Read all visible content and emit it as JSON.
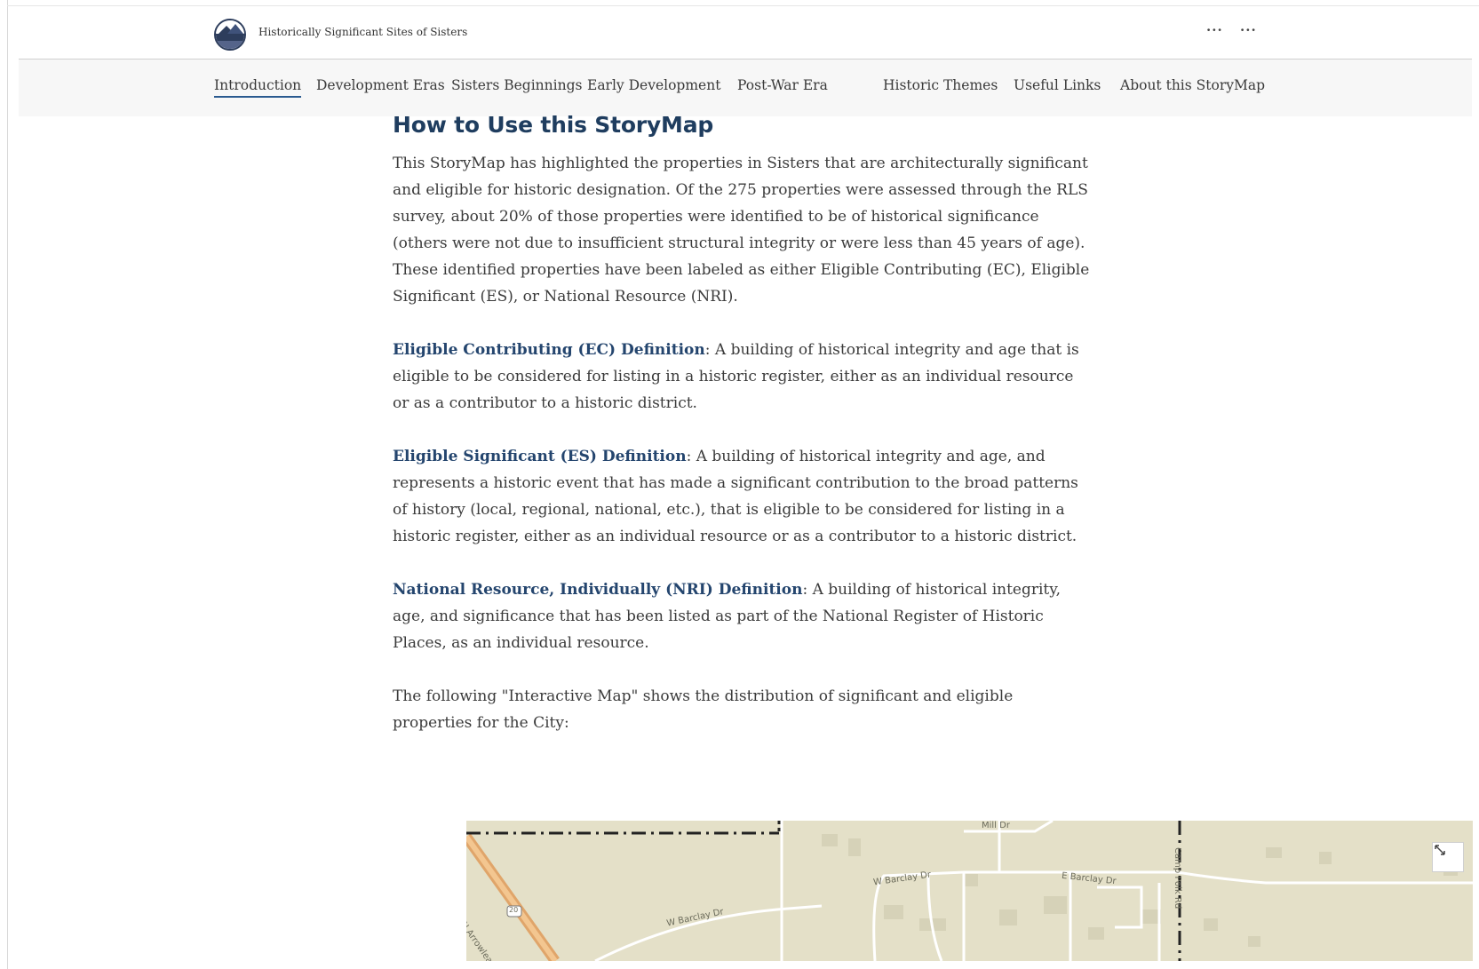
{
  "header": {
    "site_title": "Historically Significant Sites of Sisters",
    "more_1": "···",
    "more_2": "···"
  },
  "nav": {
    "items": [
      {
        "label": "Introduction",
        "active": true
      },
      {
        "label": "Development Eras"
      },
      {
        "label": "Sisters Beginnings"
      },
      {
        "label": "Early Development"
      },
      {
        "label": "Post-War Era"
      },
      {
        "label": "Historic Themes"
      },
      {
        "label": "Useful Links"
      },
      {
        "label": "About this StoryMap"
      }
    ]
  },
  "main": {
    "heading": "How to Use this StoryMap",
    "intro": "This StoryMap has highlighted the properties in Sisters that are architecturally significant and eligible for historic designation. Of the 275 properties were assessed through the RLS survey, about 20% of those properties were identified to be of historical significance (others were not due to insufficient structural integrity or were less than 45 years of age). These identified properties have been labeled as either Eligible Contributing (EC), Eligible Significant (ES), or National Resource (NRI).",
    "ec_term": "Eligible Contributing (EC) Definition",
    "ec_text": ": A building of historical integrity and age that is eligible to be considered for listing in a historic register, either as an individual resource or as a contributor to a historic district.",
    "es_term": "Eligible Significant (ES) Definition",
    "es_text": ": A building of historical integrity and age, and represents a historic event that has made a significant contribution to the broad patterns of history (local, regional, national, etc.), that is eligible to be considered for listing in a historic register, either as an individual resource or as a contributor to a historic district.",
    "nri_term": "National Resource, Individually (NRI) Definition",
    "nri_text": ": A building of historical integrity, age, and significance that has been listed as part of the National Register of Historic Places, as an individual resource.",
    "outro": "The following \"Interactive Map\" shows the distribution of significant and eligible properties for the City:"
  },
  "map": {
    "labels": {
      "w_barclay_1": "W Barclay Dr",
      "w_barclay_2": "W Barclay Dr",
      "e_barclay": "E Barclay Dr",
      "mill_dr": "Mill Dr",
      "arrowleaf": "N Arrowleaf Tr",
      "hwy_20": "20",
      "camp_polk": "Camp Polk Rd"
    },
    "colors": {
      "land": "#e4e0c8",
      "road": "#ffffff",
      "highway": "#e0a56a",
      "boundary": "#222222"
    }
  },
  "icons": {
    "logo": "city-seal-logo",
    "expand": "expand-icon",
    "more": "more-horizontal-icon"
  }
}
